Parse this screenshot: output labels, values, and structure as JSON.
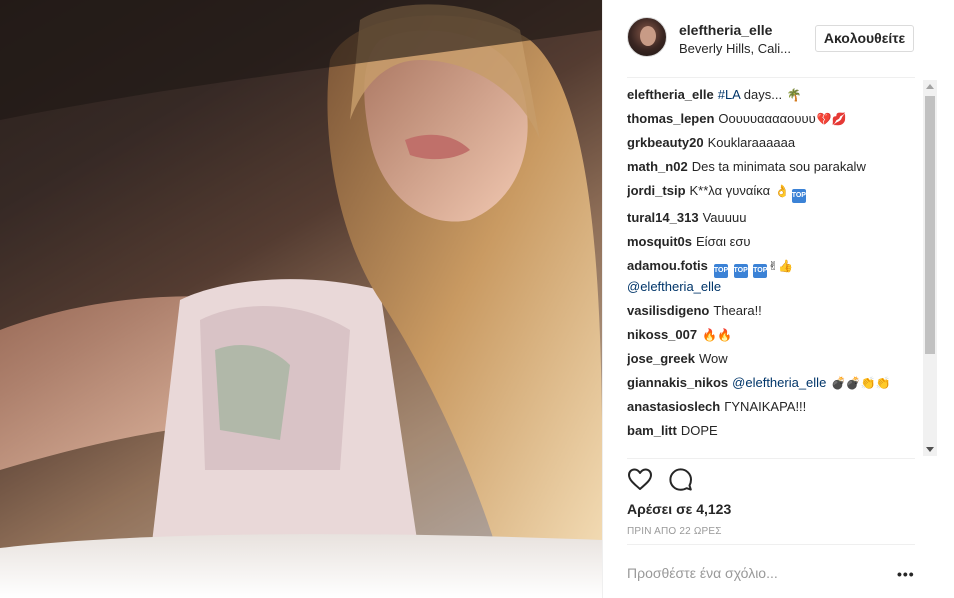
{
  "post": {
    "author": "eleftheria_elle",
    "location": "Beverly Hills, Cali...",
    "follow_label": "Ακολουθείτε",
    "caption_author": "eleftheria_elle",
    "caption_hashtag": "#LA",
    "caption_text": "days...",
    "caption_emoji": "🌴"
  },
  "comments": [
    {
      "author": "thomas_lepen",
      "text": "Οουυυααααουυυ",
      "emoji": "💔💋"
    },
    {
      "author": "grkbeauty20",
      "text": "Kouklaraaaaaa",
      "emoji": ""
    },
    {
      "author": "math_n02",
      "text": "Des ta minimata sou parakalw",
      "emoji": ""
    },
    {
      "author": "jordi_tsip",
      "text": "Κ**λα γυναίκα",
      "emoji": "👌"
    },
    {
      "author": "tural14_313",
      "text": "Vauuuu",
      "emoji": ""
    },
    {
      "author": "mosquit0s",
      "text": "Είσαι εσυ",
      "emoji": ""
    },
    {
      "author": "adamou.fotis",
      "text": "",
      "emoji": "✌👍",
      "mention": "@eleftheria_elle"
    },
    {
      "author": "vasilisdigeno",
      "text": "Theara!!",
      "emoji": ""
    },
    {
      "author": "nikoss_007",
      "text": "",
      "emoji": "🔥🔥"
    },
    {
      "author": "jose_greek",
      "text": "Wow",
      "emoji": ""
    },
    {
      "author": "giannakis_nikos",
      "text": "",
      "emoji": "💣💣👏👏",
      "mention": "@eleftheria_elle"
    },
    {
      "author": "anastasioslech",
      "text": "ΓΥΝΑΙΚΑΡΑ!!!",
      "emoji": ""
    },
    {
      "author": "bam_litt",
      "text": "DOPE",
      "emoji": ""
    }
  ],
  "badges": {
    "top": "TOP"
  },
  "likes_label": "Αρέσει σε 4,123",
  "timestamp": "ΠΡΙΝ ΑΠΟ 22 ΩΡΕΣ",
  "add_comment_placeholder": "Προσθέστε ένα σχόλιο...",
  "more_options": "•••",
  "icons": {
    "like": "heart-icon",
    "comment": "comment-bubble-icon",
    "more": "more-options-icon"
  },
  "colors": {
    "link": "#003569",
    "text": "#262626",
    "muted": "#999999",
    "border": "#efefef"
  }
}
